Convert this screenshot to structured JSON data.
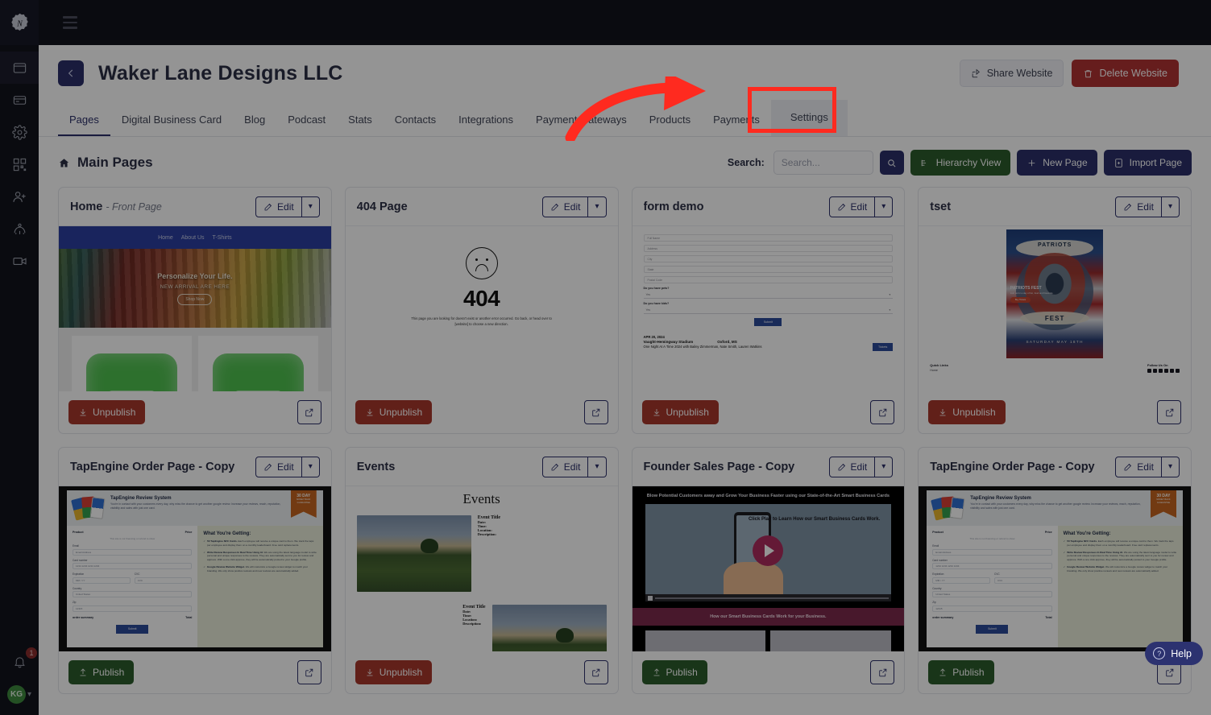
{
  "app": {
    "logo_icon": "nexus-gear-logo",
    "menu_icon": "hamburger-menu-icon",
    "rail_items": [
      {
        "name": "website-icon",
        "label": "Websites"
      },
      {
        "name": "card-icon",
        "label": "Cards"
      },
      {
        "name": "gear-icon",
        "label": "Settings"
      },
      {
        "name": "qr-code-icon",
        "label": "QR Codes"
      },
      {
        "name": "add-user-icon",
        "label": "Add User"
      },
      {
        "name": "network-icon",
        "label": "Network"
      },
      {
        "name": "video-icon",
        "label": "Video"
      }
    ],
    "notifications_count": "1",
    "avatar_initials": "KG"
  },
  "header": {
    "back_label": "←",
    "site_title": "Waker Lane Designs LLC",
    "share_label": "Share Website",
    "delete_label": "Delete Website"
  },
  "tabs": [
    {
      "label": "Pages",
      "active": true
    },
    {
      "label": "Digital Business Card",
      "active": false
    },
    {
      "label": "Blog",
      "active": false
    },
    {
      "label": "Podcast",
      "active": false
    },
    {
      "label": "Stats",
      "active": false
    },
    {
      "label": "Contacts",
      "active": false
    },
    {
      "label": "Integrations",
      "active": false
    },
    {
      "label": "Payment Gateways",
      "active": false
    },
    {
      "label": "Products",
      "active": false
    },
    {
      "label": "Payments",
      "active": false
    },
    {
      "label": "Settings",
      "active": false,
      "highlighted": true
    }
  ],
  "section": {
    "title": "Main Pages",
    "home_icon": "home-icon"
  },
  "toolbar": {
    "search_label": "Search:",
    "search_placeholder": "Search...",
    "search_value": "",
    "search_button_icon": "search-icon",
    "hierarchy_label": "Hierarchy View",
    "new_page_label": "New Page",
    "import_page_label": "Import Page"
  },
  "card_common": {
    "edit_label": "Edit",
    "caret_icon": "chevron-down-icon",
    "external_icon": "external-link-icon",
    "unpublish_label": "Unpublish",
    "publish_label": "Publish"
  },
  "cards": [
    {
      "title": "Home",
      "subtitle": "- Front Page",
      "state_label": "Unpublish",
      "state": "published",
      "thumb": {
        "type": "home",
        "nav": [
          "Home",
          "About Us",
          "T-Shirts"
        ],
        "headline": "Personalize Your Life.",
        "subhead": "NEW ARRIVAL ARE HERE",
        "cta": "Shop Now"
      }
    },
    {
      "title": "404 Page",
      "subtitle": "",
      "state_label": "Unpublish",
      "state": "published",
      "thumb": {
        "type": "404",
        "code": "404",
        "face_icon": "sad-face-icon",
        "desc": "This page you are looking for doesn't exist or another error occurred. Go back, or head over to [website] to choose a new direction."
      }
    },
    {
      "title": "form demo",
      "subtitle": "",
      "state_label": "Unpublish",
      "state": "published",
      "thumb": {
        "type": "form",
        "fields": [
          "Full Name",
          "Address",
          "City",
          "State",
          "Postal Code"
        ],
        "questions": [
          {
            "label": "Do you have pets?",
            "value": "Yes"
          },
          {
            "label": "Do you have kids?",
            "value": "Yes"
          }
        ],
        "submit": "Submit",
        "event": {
          "date": "APR 20, 2024",
          "venue": "Vaught-Hemingway Stadium",
          "city": "Oxford, MS",
          "detail": "One Night At A Time 2024 with Bailey Zimmerman, Nate Smith, Lauren Watkins",
          "tickets": "Tickets"
        }
      }
    },
    {
      "title": "tset",
      "subtitle": "",
      "state_label": "Unpublish",
      "state": "published",
      "thumb": {
        "type": "tset",
        "poster_top": "PATRIOTS",
        "poster_bottom": "FEST",
        "poster_date": "SATURDAY MAY 18TH",
        "overlay_title": "PATRIOTS FEST",
        "overlay_sub": "Join us for a day of fun, food and fireworks",
        "overlay_cta": "Buy Tickets",
        "footer_links_title": "Quick Links",
        "footer_link": "Home",
        "footer_follow": "Follow Us On"
      }
    },
    {
      "title": "TapEngine Order Page - Copy",
      "subtitle": "",
      "state_label": "Publish",
      "state": "unpublished",
      "thumb": {
        "type": "tapengine",
        "heading": "TapEngine Review System",
        "body": "You're in contact with your customers every day, why miss the chance to get another google review. Increase your reviews, reach, reputation, visibility and sales with just one card.",
        "badge_top": "30 DAY",
        "badge_bottom": "MONEY BACK GUARANTEE",
        "form_header_left": "Product",
        "form_header_right": "Price",
        "form_note": "This site is not financing or refund to show",
        "fields": [
          {
            "label": "Email",
            "value": "Email Address"
          },
          {
            "label": "Card number",
            "value": "1234 1234 1234 1234"
          },
          {
            "label": "Expiration",
            "value": "MM / YY"
          },
          {
            "label": "CVC",
            "value": "CVC"
          },
          {
            "label": "Country",
            "value": "United States"
          },
          {
            "label": "Zip",
            "value": "12315"
          }
        ],
        "order_summary": "order summary",
        "total_label": "Total",
        "submit": "Submit",
        "right_heading": "What You're Getting:",
        "right_items": [
          {
            "bold": "50 TapEngine NFC Cards.",
            "text": "Each employee will receive a unique card to them. We track the taps per employee and display them on a monthly leaderboard. Free card replacements."
          },
          {
            "bold": "Write Review Responses In Real Time Using AI.",
            "text": "We are using the latest language model to write personal and unique responses to the reviews. They are automatically sent to you for review and approve. With a one click approve, they will be automatically posted to your Google profile."
          },
          {
            "bold": "Google Review Website Widget.",
            "text": "We will customize a Google review widget to match your branding. We only show positive reviews and new reviews are automatically added."
          }
        ]
      }
    },
    {
      "title": "Events",
      "subtitle": "",
      "state_label": "Unpublish",
      "state": "published",
      "thumb": {
        "type": "events",
        "heading": "Events",
        "entries": [
          {
            "title": "Event Title",
            "date": "Date:",
            "time": "Time:",
            "location": "Location:",
            "description": "Description:"
          },
          {
            "title": "Event Title",
            "date": "Date:",
            "time": "Time:",
            "location": "Location:",
            "description": "Description:"
          }
        ]
      }
    },
    {
      "title": "Founder Sales Page - Copy",
      "subtitle": "",
      "state_label": "Publish",
      "state": "unpublished",
      "thumb": {
        "type": "founder",
        "headline": "Blow Potential Customers away and Grow Your Business Faster using our State-of-the-Art Smart Business Cards",
        "video_cta": "Click Play to Learn How our Smart Business Cards Work.",
        "play_icon": "play-button-icon",
        "footer": "How our Smart Business Cards Work for your Business."
      }
    },
    {
      "title": "TapEngine Order Page - Copy",
      "subtitle": "",
      "state_label": "Publish",
      "state": "unpublished",
      "thumb": {
        "type": "tapengine",
        "heading": "TapEngine Review System",
        "body": "You're in contact with your customers every day, why miss the chance to get another google review. Increase your reviews, reach, reputation, visibility and sales with just one card.",
        "badge_top": "30 DAY",
        "badge_bottom": "MONEY BACK GUARANTEE",
        "form_header_left": "Product",
        "form_header_right": "Price",
        "form_note": "This site is not financing or refund to show",
        "fields": [
          {
            "label": "Email",
            "value": "Email Address"
          },
          {
            "label": "Card number",
            "value": "1234 1234 1234 1234"
          },
          {
            "label": "Expiration",
            "value": "MM / YY"
          },
          {
            "label": "CVC",
            "value": "CVC"
          },
          {
            "label": "Country",
            "value": "United States"
          },
          {
            "label": "Zip",
            "value": "12315"
          }
        ],
        "order_summary": "order summary",
        "total_label": "Total",
        "submit": "Submit",
        "right_heading": "What You're Getting:",
        "right_items": [
          {
            "bold": "50 TapEngine NFC Cards.",
            "text": "Each employee will receive a unique card to them. We track the taps per employee and display them on a monthly leaderboard. Free card replacements."
          },
          {
            "bold": "Write Review Responses In Real Time Using AI.",
            "text": "We are using the latest language model to write personal and unique responses to the reviews. They are automatically sent to you for review and approve. With a one click approve, they will be automatically posted to your Google profile."
          },
          {
            "bold": "Google Review Website Widget.",
            "text": "We will customize a Google review widget to match your branding. We only show positive reviews and new reviews are automatically added."
          }
        ]
      }
    }
  ],
  "annotation": {
    "highlight_target": "Settings",
    "arrow_color": "#ff2a1f",
    "highlight_color": "#ff2a1f"
  },
  "help_widget": {
    "label": "Help",
    "icon": "question-circle-icon"
  },
  "colors": {
    "navy": "#2b3069",
    "green": "#2b5c2b",
    "red": "#a8382c",
    "dark_rail": "#12131c",
    "accent_red": "#ff2a1f"
  }
}
